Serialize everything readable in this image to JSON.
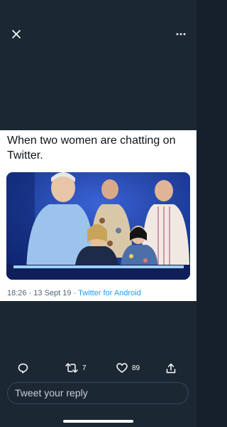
{
  "header": {
    "close_icon": "close-icon",
    "more_icon": "more-horizontal-icon"
  },
  "tweet": {
    "text": "When two women are chatting on Twitter.",
    "media_icon": "photo",
    "timestamp": "18:26 · 13 Sept 19 · ",
    "source": "Twitter for Android"
  },
  "actions": {
    "reply_icon": "reply-icon",
    "retweet_icon": "retweet-icon",
    "retweet_count": "7",
    "like_icon": "heart-icon",
    "like_count": "89",
    "share_icon": "share-icon"
  },
  "reply": {
    "placeholder": "Tweet your reply"
  },
  "colors": {
    "background": "#1b2733",
    "card": "#ffffff",
    "link": "#1d9bf0",
    "muted_text": "#536471"
  }
}
